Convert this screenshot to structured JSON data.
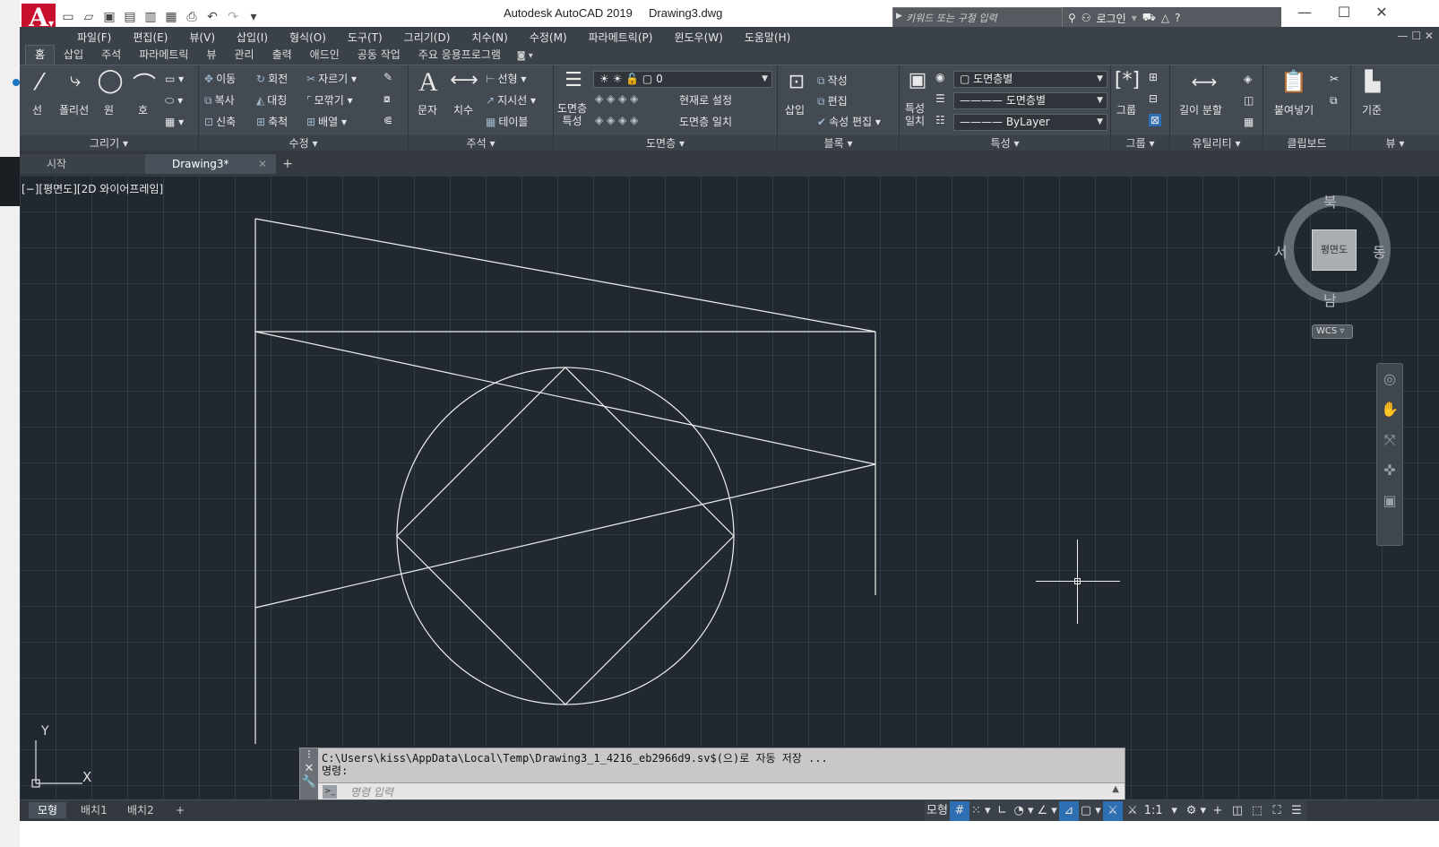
{
  "app": {
    "title": "Autodesk AutoCAD 2019",
    "document": "Drawing3.dwg",
    "logo_letter": "A",
    "search_placeholder": "키워드 또는 구절 입력",
    "login_label": "로그인"
  },
  "menu": [
    "파일(F)",
    "편집(E)",
    "뷰(V)",
    "삽입(I)",
    "형식(O)",
    "도구(T)",
    "그리기(D)",
    "치수(N)",
    "수정(M)",
    "파라메트릭(P)",
    "윈도우(W)",
    "도움말(H)"
  ],
  "ribbon_tabs": [
    "홈",
    "삽입",
    "주석",
    "파라메트릭",
    "뷰",
    "관리",
    "출력",
    "애드인",
    "공동 작업",
    "주요 응용프로그램"
  ],
  "ribbon": {
    "draw": {
      "title": "그리기",
      "line": "선",
      "polyline": "폴리선",
      "circle": "원",
      "arc": "호"
    },
    "modify": {
      "title": "수정",
      "move": "이동",
      "rotate": "회전",
      "trim": "자르기",
      "copy": "복사",
      "mirror": "대칭",
      "fillet": "모깎기",
      "stretch": "신축",
      "scale": "축척",
      "array": "배열"
    },
    "annotation": {
      "title": "주석",
      "text": "문자",
      "dimension": "치수",
      "linear": "선형",
      "leader": "지시선",
      "table": "테이블"
    },
    "layers": {
      "title": "도면층",
      "properties_line1": "도면층",
      "properties_line2": "특성",
      "current_layer": "0",
      "make_current": "현재로 설정",
      "match_layer": "도면층 일치"
    },
    "block": {
      "title": "블록",
      "insert": "삽입",
      "create": "작성",
      "edit": "편집",
      "edit_attributes": "속성 편집"
    },
    "properties": {
      "title": "특성",
      "match_line1": "특성",
      "match_line2": "일치",
      "color": "도면층별",
      "linetype": "도면층별",
      "lineweight": "ByLayer"
    },
    "groups": {
      "title": "그룹",
      "group": "그룹"
    },
    "utilities": {
      "title": "유틸리티",
      "measure": "길이 분할"
    },
    "clipboard": {
      "title": "클립보드",
      "paste": "붙여넣기"
    },
    "view": {
      "title": "뷰",
      "base": "기준"
    }
  },
  "file_tabs": {
    "start": "시작",
    "doc": "Drawing3*"
  },
  "viewport": {
    "label": "[−][평면도][2D 와이어프레임]",
    "viewcube": {
      "face": "평면도",
      "north": "북",
      "south": "남",
      "east": "동",
      "west": "서"
    },
    "wcs": "WCS",
    "ucs": {
      "x": "X",
      "y": "Y"
    }
  },
  "command": {
    "history_line1": "C:\\Users\\kiss\\AppData\\Local\\Temp\\Drawing3_1_4216_eb2966d9.sv$(으)로 자동 저장 ...",
    "history_line2": "명령:",
    "placeholder": "명령 입력"
  },
  "status": {
    "layout_tabs": [
      "모형",
      "배치1",
      "배치2"
    ],
    "model_label": "모형",
    "scale": "1:1"
  },
  "colors": {
    "canvas_bg": "#212830",
    "ribbon_bg": "#434a52",
    "logo_red": "#c8102e",
    "active_toggle": "#2e6fb3"
  }
}
